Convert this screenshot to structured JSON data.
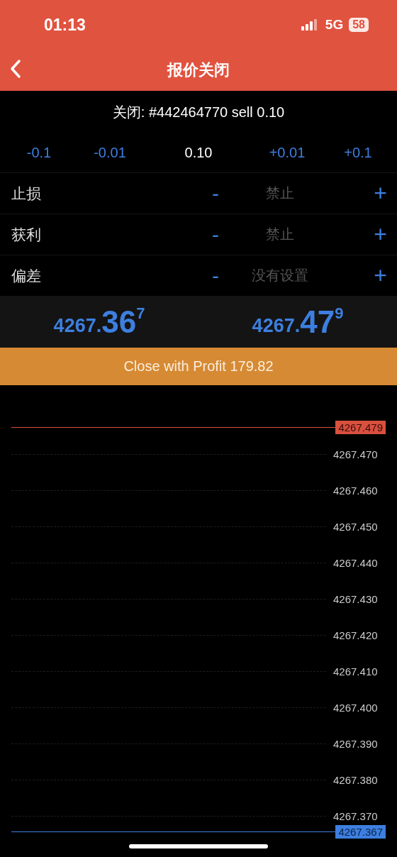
{
  "status_bar": {
    "time": "01:13",
    "network": "5G",
    "battery": "58"
  },
  "nav": {
    "title": "报价关闭"
  },
  "order": {
    "title": "关闭: #442464770 sell 0.10"
  },
  "volume": {
    "steps": [
      {
        "label": "-0.1",
        "kind": "step"
      },
      {
        "label": "-0.01",
        "kind": "step"
      },
      {
        "label": "0.10",
        "kind": "value"
      },
      {
        "label": "+0.01",
        "kind": "step"
      },
      {
        "label": "+0.1",
        "kind": "step"
      }
    ]
  },
  "settings": [
    {
      "label": "止损",
      "minus": "-",
      "value": "禁止",
      "plus": "+"
    },
    {
      "label": "获利",
      "minus": "-",
      "value": "禁止",
      "plus": "+"
    },
    {
      "label": "偏差",
      "minus": "-",
      "value": "没有设置",
      "plus": "+"
    }
  ],
  "quotes": [
    {
      "prefix": "4267.",
      "big": "36",
      "sup": "7"
    },
    {
      "prefix": "4267.",
      "big": "47",
      "sup": "9"
    }
  ],
  "close_button": {
    "label": "Close with Profit 179.82"
  },
  "price_scale": {
    "ask_label": "4267.479",
    "bid_label": "4267.367",
    "ticks": [
      "4267.470",
      "4267.460",
      "4267.450",
      "4267.440",
      "4267.430",
      "4267.420",
      "4267.410",
      "4267.400",
      "4267.390",
      "4267.380",
      "4267.370"
    ]
  }
}
